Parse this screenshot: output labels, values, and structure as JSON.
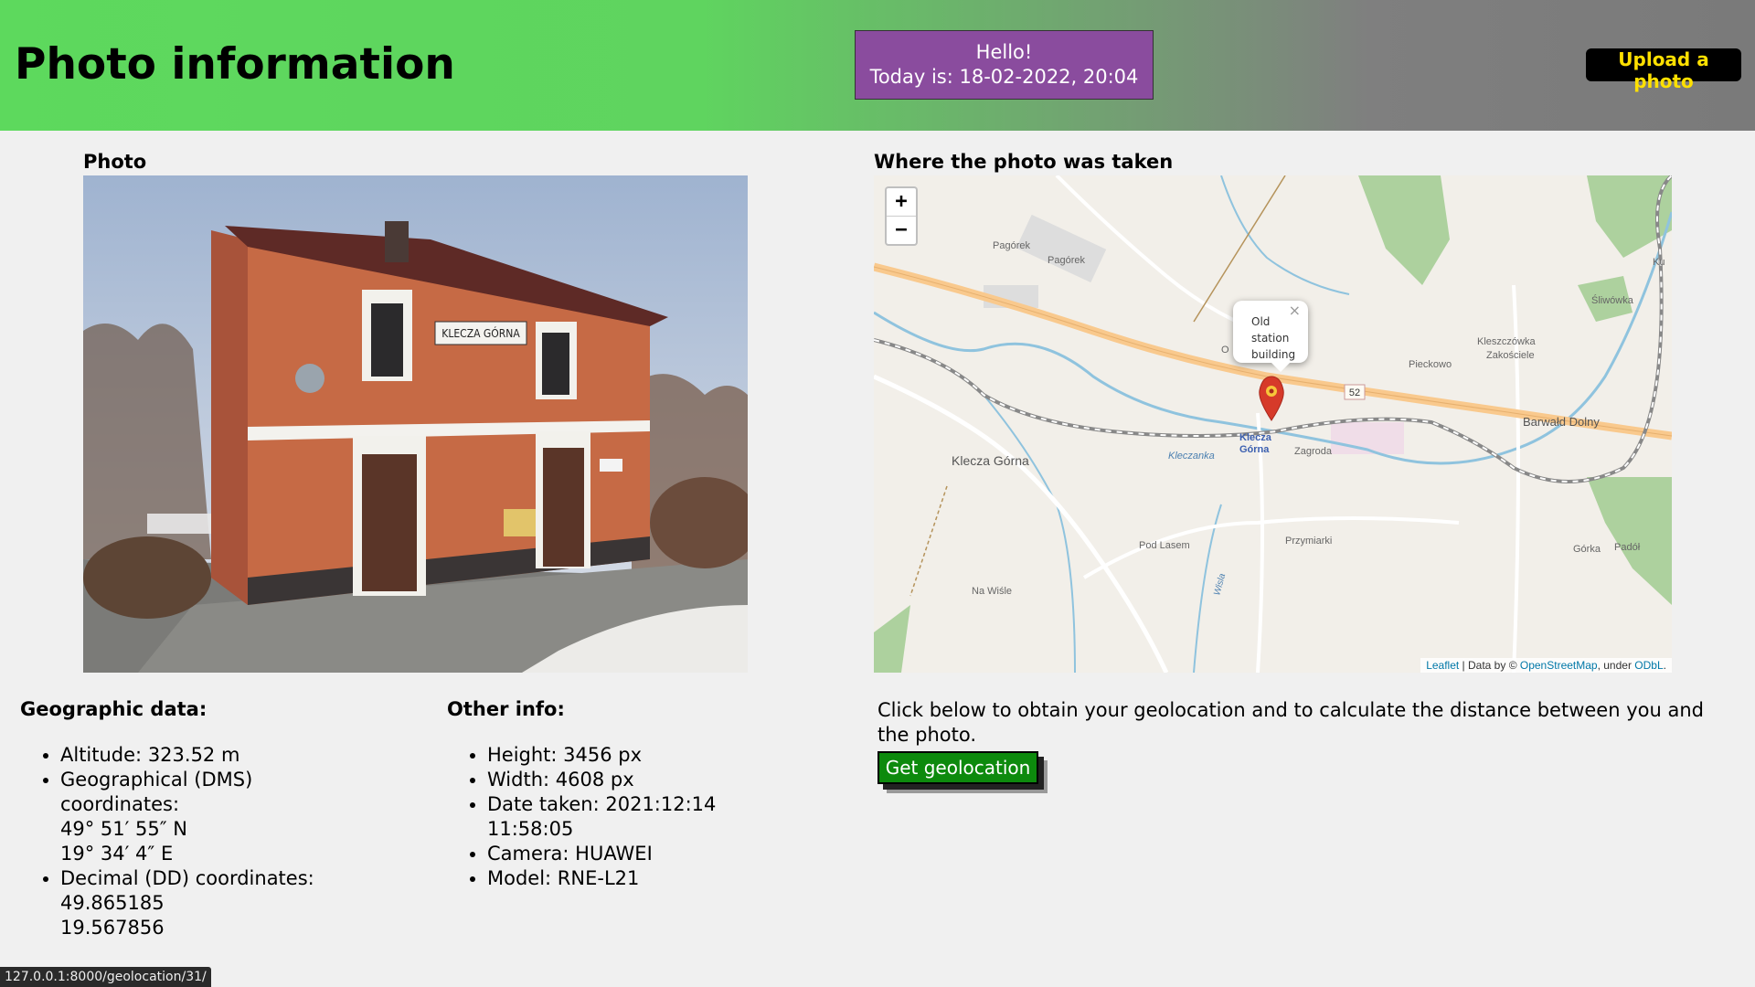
{
  "header": {
    "title": "Photo information",
    "greeting_line1": "Hello!",
    "greeting_line2": "Today is: 18-02-2022, 20:04",
    "upload_label": "Upload a photo"
  },
  "photo_section": {
    "heading": "Photo",
    "station_sign": "KLECZA GÓRNA"
  },
  "map_section": {
    "heading": "Where the photo was taken",
    "zoom_in": "+",
    "zoom_out": "−",
    "popup_text": [
      "Old",
      "station",
      "building"
    ],
    "popup_close": "×",
    "road_number": "52",
    "labels": {
      "pagorek1": "Pagórek",
      "pagorek2": "Pagórek",
      "klecza_gorna": "Klecza Górna",
      "station": "Klecza",
      "station2": "Górna",
      "kleczanka": "Kleczanka",
      "zagroda": "Zagroda",
      "pod_lasem": "Pod Lasem",
      "przymiarki": "Przymiarki",
      "na_wisle": "Na Wiśle",
      "pieckowo": "Pieckowo",
      "kleszczowka": "Kleszczówka",
      "zakoscicie": "Zakościele",
      "slimowka": "Śliwówka",
      "barwald": "Barwałd Dolny",
      "gorka": "Górka",
      "padol": "Padół",
      "ku": "Ku",
      "o": "O",
      "wisla": "Wisla"
    },
    "attribution": {
      "leaflet": "Leaflet",
      "mid": " | Data by © ",
      "osm": "OpenStreetMap",
      "under": ", under ",
      "odbl": "ODbL",
      "end": "."
    }
  },
  "geographic": {
    "heading": "Geographic data:",
    "altitude": "Altitude: 323.52 m",
    "dms_label": "Geographical (DMS)",
    "dms_label2": "coordinates:",
    "dms_lat": "49° 51′ 55″ N",
    "dms_lon": "19° 34′ 4″ E",
    "dd_label": "Decimal (DD) coordinates:",
    "dd_lat": "49.865185",
    "dd_lon": "19.567856"
  },
  "other": {
    "heading": "Other info:",
    "height": "Height: 3456 px",
    "width": "Width: 4608 px",
    "date_taken": "Date taken: 2021:12:14",
    "date_time": "11:58:05",
    "camera": "Camera: HUAWEI",
    "model": "Model: RNE-L21"
  },
  "geolocation": {
    "text": "Click below to obtain your geolocation and to calculate the distance between you and the photo.",
    "button": "Get geolocation"
  },
  "status_bar": {
    "url": "127.0.0.1:8000/geolocation/31/"
  },
  "colors": {
    "header_green": "#5dd95d",
    "header_grey": "#7f7f7f",
    "greeting_bg": "#8a4c9e",
    "upload_text": "#ffe000",
    "geo_button": "#0d8a0d"
  }
}
